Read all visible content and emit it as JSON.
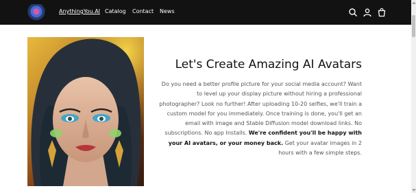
{
  "header": {
    "brand": "AnythingYou.AI",
    "nav": [
      "Catalog",
      "Contact",
      "News"
    ],
    "icons": [
      "search-icon",
      "account-icon",
      "cart-icon"
    ],
    "background": "#121212"
  },
  "hero": {
    "title": "Let's Create Amazing AI Avatars",
    "intro": "Do you need a better profile picture for your social media account? Want to level up your display picture without hiring a professional photographer? Look no further! After uploading 10-20 selfies, we'll train a custom model for you immediately. Once training is done, you'll get an email with image and Stable Diffusion model download links. No subscriptions. No app Installs.",
    "highlight": "We're confident you'll be happy with your AI avatars, or your money back.",
    "outro": "Get your avatar images in 2 hours with a few simple steps."
  }
}
